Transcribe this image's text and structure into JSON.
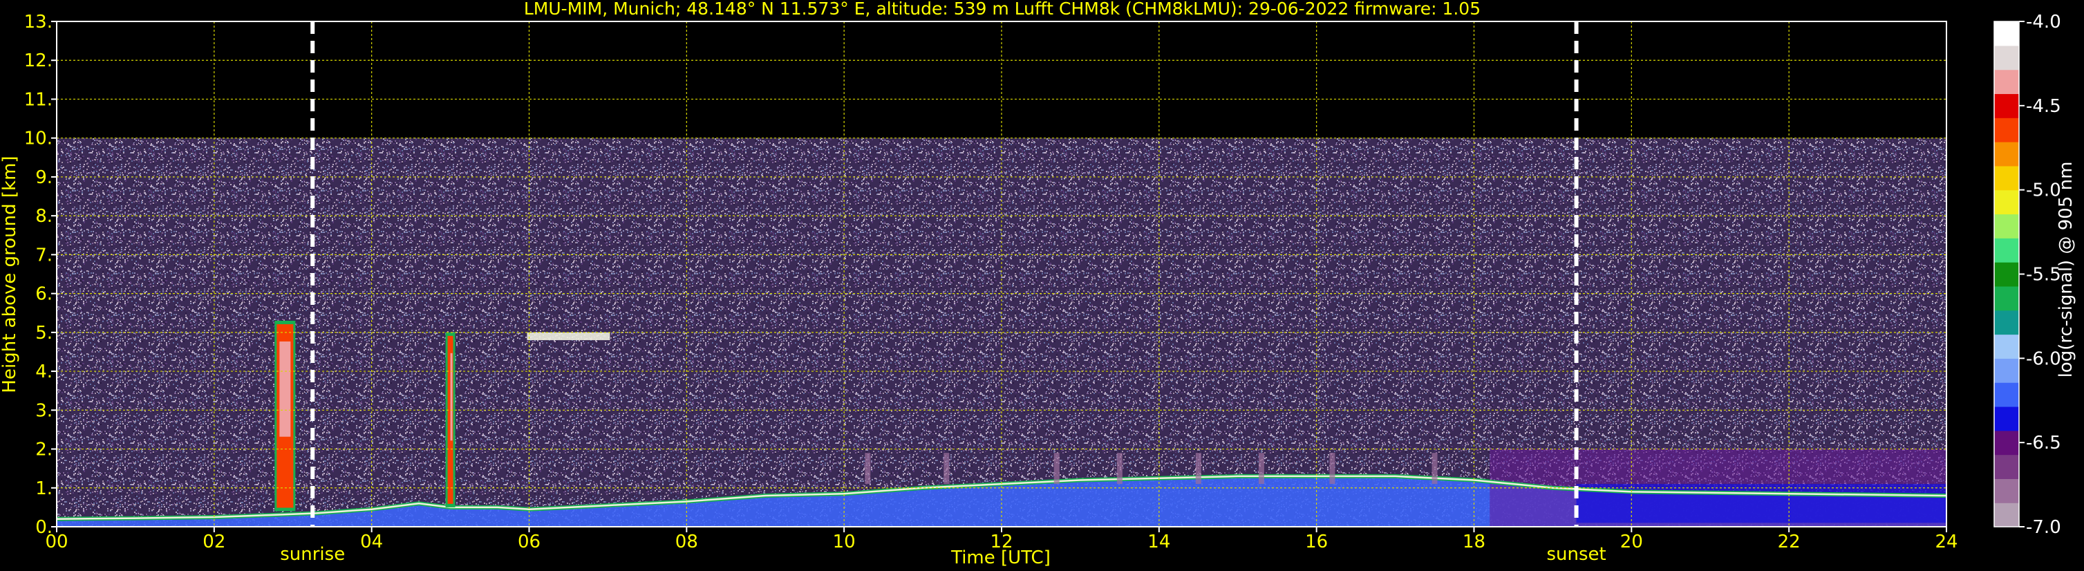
{
  "chart_data": {
    "type": "heatmap",
    "title": "LMU-MIM, Munich; 48.148° N 11.573° E, altitude: 539 m    Lufft CHM8k (CHM8kLMU): 29-06-2022    firmware: 1.05",
    "xlabel": "Time [UTC]",
    "ylabel": "Height above ground [km]",
    "xlim": [
      0,
      24
    ],
    "ylim": [
      0,
      13
    ],
    "x_ticks": [
      "00",
      "02",
      "04",
      "06",
      "08",
      "10",
      "12",
      "14",
      "16",
      "18",
      "20",
      "22",
      "24"
    ],
    "y_ticks": [
      "0.",
      "1.",
      "2.",
      "3.",
      "4.",
      "5.",
      "6.",
      "7.",
      "8.",
      "9.",
      "10.",
      "11.",
      "12.",
      "13."
    ],
    "grid": true,
    "data_top_km": 10,
    "markers": [
      {
        "label": "sunrise",
        "x": 3.25
      },
      {
        "label": "sunset",
        "x": 19.3
      }
    ],
    "boundary_layer_km": [
      [
        0,
        0.2
      ],
      [
        1,
        0.22
      ],
      [
        2,
        0.25
      ],
      [
        2.7,
        0.3
      ],
      [
        3.3,
        0.35
      ],
      [
        4,
        0.45
      ],
      [
        4.6,
        0.6
      ],
      [
        5,
        0.5
      ],
      [
        5.6,
        0.5
      ],
      [
        6,
        0.45
      ],
      [
        7,
        0.55
      ],
      [
        8,
        0.65
      ],
      [
        9,
        0.8
      ],
      [
        10,
        0.85
      ],
      [
        11,
        1.0
      ],
      [
        12,
        1.1
      ],
      [
        13,
        1.2
      ],
      [
        14,
        1.25
      ],
      [
        15,
        1.3
      ],
      [
        16,
        1.3
      ],
      [
        17,
        1.3
      ],
      [
        18,
        1.2
      ],
      [
        19,
        1.0
      ],
      [
        20,
        0.9
      ],
      [
        22,
        0.85
      ],
      [
        24,
        0.8
      ]
    ],
    "cloud_features": [
      {
        "x": 2.9,
        "y_bottom": 0.4,
        "y_top": 5.3
      },
      {
        "x": 5.0,
        "y_bottom": 0.5,
        "y_top": 5.0
      },
      {
        "x": 6.5,
        "y_bottom": 4.8,
        "y_top": 5.0
      }
    ],
    "colorbar": {
      "label": "log(rc-signal) @ 905 nm",
      "range": [
        -7.0,
        -4.0
      ],
      "ticks": [
        "-4.0",
        "-4.5",
        "-5.0",
        "-5.5",
        "-6.0",
        "-6.5",
        "-7.0"
      ],
      "colors": [
        "#b4a0b4",
        "#9c709c",
        "#7a3a84",
        "#640f7a",
        "#1010e0",
        "#3c64f8",
        "#78a0f8",
        "#a0c8f8",
        "#109890",
        "#18b050",
        "#109010",
        "#40e080",
        "#a0f060",
        "#f0f020",
        "#f8d000",
        "#f89000",
        "#f84000",
        "#e00000",
        "#f0a0a0",
        "#e0d8d8",
        "#ffffff"
      ]
    }
  }
}
